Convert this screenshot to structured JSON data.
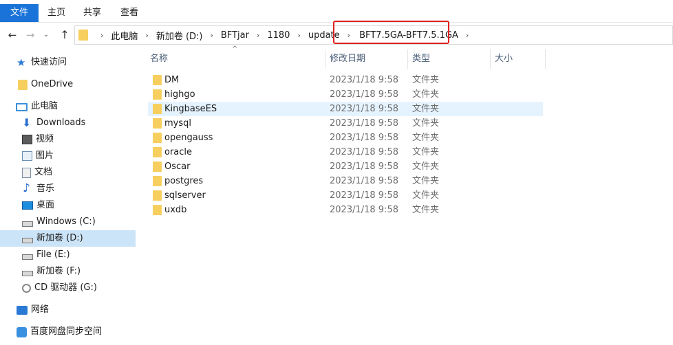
{
  "ribbon": {
    "tabs": [
      {
        "label": "文件"
      },
      {
        "label": "主页"
      },
      {
        "label": "共享"
      },
      {
        "label": "查看"
      }
    ]
  },
  "address": {
    "crumbs": [
      "此电脑",
      "新加卷 (D:)",
      "BFTjar",
      "1180",
      "update",
      "BFT7.5GA-BFT7.5.1GA"
    ],
    "highlighted": "BFT7.5GA-BFT7.5.1GA",
    "highlight_color": "#e02020"
  },
  "sidebar": {
    "items": [
      {
        "label": "快速访问",
        "icon": "star-icon"
      },
      {
        "label": "OneDrive",
        "icon": "folder-icon"
      },
      {
        "label": "此电脑",
        "icon": "computer-icon"
      },
      {
        "label": "Downloads",
        "icon": "download-icon"
      },
      {
        "label": "视频",
        "icon": "video-icon"
      },
      {
        "label": "图片",
        "icon": "picture-icon"
      },
      {
        "label": "文档",
        "icon": "document-icon"
      },
      {
        "label": "音乐",
        "icon": "music-icon"
      },
      {
        "label": "桌面",
        "icon": "desktop-icon"
      },
      {
        "label": "Windows (C:)",
        "icon": "drive-icon"
      },
      {
        "label": "新加卷 (D:)",
        "icon": "drive-icon",
        "selected": true
      },
      {
        "label": "File (E:)",
        "icon": "drive-icon"
      },
      {
        "label": "新加卷 (F:)",
        "icon": "drive-icon"
      },
      {
        "label": "CD 驱动器 (G:)",
        "icon": "cd-icon"
      },
      {
        "label": "网络",
        "icon": "network-icon"
      },
      {
        "label": "百度网盘同步空间",
        "icon": "cloud-icon"
      }
    ]
  },
  "columns": {
    "name": "名称",
    "modified": "修改日期",
    "type": "类型",
    "size": "大小"
  },
  "files": [
    {
      "name": "DM",
      "modified": "2023/1/18 9:58",
      "type": "文件夹"
    },
    {
      "name": "highgo",
      "modified": "2023/1/18 9:58",
      "type": "文件夹"
    },
    {
      "name": "KingbaseES",
      "modified": "2023/1/18 9:58",
      "type": "文件夹",
      "hover": true
    },
    {
      "name": "mysql",
      "modified": "2023/1/18 9:58",
      "type": "文件夹"
    },
    {
      "name": "opengauss",
      "modified": "2023/1/18 9:58",
      "type": "文件夹"
    },
    {
      "name": "oracle",
      "modified": "2023/1/18 9:58",
      "type": "文件夹"
    },
    {
      "name": "Oscar",
      "modified": "2023/1/18 9:58",
      "type": "文件夹"
    },
    {
      "name": "postgres",
      "modified": "2023/1/18 9:58",
      "type": "文件夹"
    },
    {
      "name": "sqlserver",
      "modified": "2023/1/18 9:58",
      "type": "文件夹"
    },
    {
      "name": "uxdb",
      "modified": "2023/1/18 9:58",
      "type": "文件夹"
    }
  ]
}
